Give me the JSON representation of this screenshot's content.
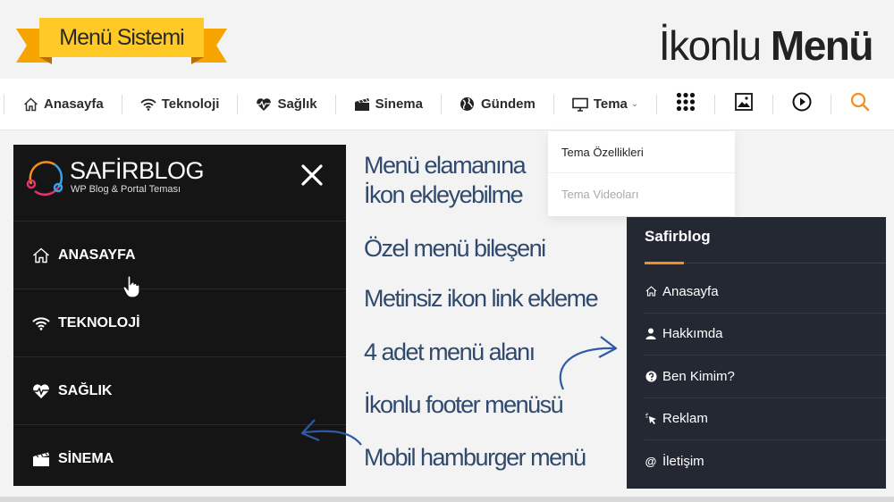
{
  "banner": {
    "ribbon_label": "Menü Sistemi",
    "brand_thin": "İkonlu",
    "brand_bold": "Menü",
    "ribbon_color": "#ffc928",
    "ribbon_tail_color": "#f5a400"
  },
  "nav": {
    "items": [
      {
        "label": "Anasayfa",
        "icon": "home-icon"
      },
      {
        "label": "Teknoloji",
        "icon": "wifi-icon"
      },
      {
        "label": "Sağlık",
        "icon": "heartbeat-icon"
      },
      {
        "label": "Sinema",
        "icon": "clapperboard-icon"
      },
      {
        "label": "Gündem",
        "icon": "globe-icon"
      },
      {
        "label": "Tema",
        "icon": "monitor-icon",
        "has_dropdown": true
      }
    ],
    "icon_links": [
      "grid-icon",
      "image-icon",
      "play-icon",
      "search-icon"
    ],
    "search_color": "#f3901d"
  },
  "dropdown": {
    "items": [
      "Tema Özellikleri",
      "Tema Videoları"
    ]
  },
  "mobile_menu": {
    "logo_text": "SAFİRBLOG",
    "logo_subtitle": "WP Blog & Portal Teması",
    "items": [
      {
        "label": "ANASAYFA",
        "icon": "home-icon"
      },
      {
        "label": "TEKNOLOJİ",
        "icon": "wifi-icon"
      },
      {
        "label": "SAĞLIK",
        "icon": "heartbeat-icon"
      },
      {
        "label": "SİNEMA",
        "icon": "clapperboard-icon"
      }
    ]
  },
  "features": [
    "Menü elamanına",
    "İkon ekleyebilme",
    "Özel menü bileşeni",
    "Metinsiz ikon link ekleme",
    "4 adet menü alanı",
    "İkonlu footer menüsü",
    "Mobil hamburger menü"
  ],
  "footer_menu": {
    "title": "Safirblog",
    "accent_color": "#f3901d",
    "items": [
      {
        "label": "Anasayfa",
        "icon": "home-icon"
      },
      {
        "label": "Hakkımda",
        "icon": "user-icon"
      },
      {
        "label": "Ben Kimim?",
        "icon": "question-icon"
      },
      {
        "label": "Reklam",
        "icon": "pointer-icon"
      },
      {
        "label": "İletişim",
        "icon": "at-icon"
      }
    ]
  }
}
